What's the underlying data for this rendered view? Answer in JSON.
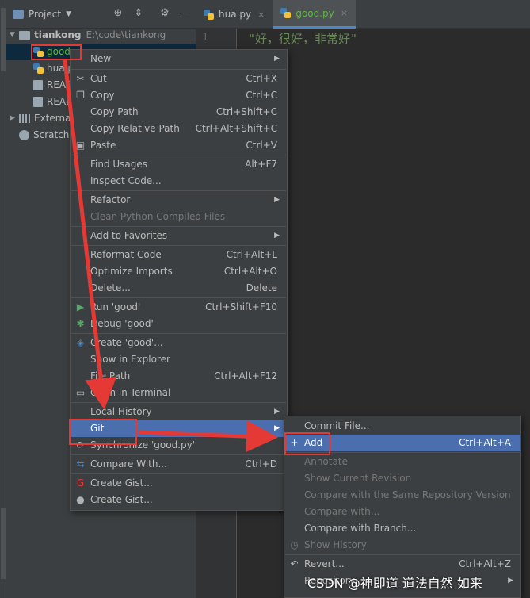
{
  "project_panel": {
    "title": "Project",
    "header_icons": [
      "crosshair-icon",
      "collapse-icon",
      "gear-icon",
      "minimize-icon"
    ],
    "tree": {
      "root_name": "tiankong",
      "root_path": "E:\\code\\tiankong",
      "files": [
        "good.py",
        "hua.py",
        "README",
        "README"
      ],
      "external_libraries": "External Libraries",
      "scratches": "Scratches and Consoles"
    }
  },
  "editor": {
    "tabs": [
      {
        "label": "hua.py",
        "icon": "python-file-icon"
      },
      {
        "label": "good.py",
        "icon": "python-file-icon",
        "active": true
      }
    ],
    "close_glyph": "×",
    "line_number": "1",
    "code": "\"好，很好，非常好\""
  },
  "context_menu": {
    "items": [
      {
        "label": "New",
        "shortcut": "",
        "submenu": true
      },
      {
        "label": "Cut",
        "shortcut": "Ctrl+X",
        "icon": "scissors-icon"
      },
      {
        "label": "Copy",
        "shortcut": "Ctrl+C",
        "icon": "copy-icon"
      },
      {
        "label": "Copy Path",
        "shortcut": "Ctrl+Shift+C"
      },
      {
        "label": "Copy Relative Path",
        "shortcut": "Ctrl+Alt+Shift+C"
      },
      {
        "label": "Paste",
        "shortcut": "Ctrl+V",
        "icon": "clipboard-icon"
      },
      {
        "label": "Find Usages",
        "shortcut": "Alt+F7"
      },
      {
        "label": "Inspect Code...",
        "shortcut": ""
      },
      {
        "label": "Refactor",
        "shortcut": "",
        "submenu": true
      },
      {
        "label": "Clean Python Compiled Files",
        "shortcut": "",
        "disabled": true
      },
      {
        "label": "Add to Favorites",
        "shortcut": "",
        "submenu": true
      },
      {
        "label": "Reformat Code",
        "shortcut": "Ctrl+Alt+L"
      },
      {
        "label": "Optimize Imports",
        "shortcut": "Ctrl+Alt+O"
      },
      {
        "label": "Delete...",
        "shortcut": "Delete"
      },
      {
        "label": "Run 'good'",
        "shortcut": "Ctrl+Shift+F10",
        "icon": "run-icon"
      },
      {
        "label": "Debug 'good'",
        "shortcut": "",
        "icon": "debug-icon"
      },
      {
        "label": "Create 'good'...",
        "shortcut": "",
        "icon": "python-icon"
      },
      {
        "label": "Show in Explorer",
        "shortcut": ""
      },
      {
        "label": "File Path",
        "shortcut": "Ctrl+Alt+F12"
      },
      {
        "label": "Open in Terminal",
        "shortcut": "",
        "icon": "terminal-icon"
      },
      {
        "label": "Local History",
        "shortcut": "",
        "submenu": true
      },
      {
        "label": "Git",
        "shortcut": "",
        "submenu": true,
        "highlighted": true
      },
      {
        "label": "Synchronize 'good.py'",
        "shortcut": "",
        "icon": "sync-icon"
      },
      {
        "label": "Compare With...",
        "shortcut": "Ctrl+D",
        "icon": "compare-icon"
      },
      {
        "label": "Create Gist...",
        "shortcut": "",
        "icon": "gist-g-icon"
      },
      {
        "label": "Create Gist...",
        "shortcut": "",
        "icon": "github-icon"
      }
    ]
  },
  "git_submenu": {
    "items": [
      {
        "label": "Commit File...",
        "shortcut": ""
      },
      {
        "label": "Add",
        "shortcut": "Ctrl+Alt+A",
        "icon": "plus-icon",
        "highlighted": true
      },
      {
        "label": "Annotate",
        "shortcut": "",
        "disabled": true
      },
      {
        "label": "Show Current Revision",
        "shortcut": "",
        "disabled": true
      },
      {
        "label": "Compare with the Same Repository Version",
        "shortcut": "",
        "disabled": true
      },
      {
        "label": "Compare with...",
        "shortcut": "",
        "disabled": true
      },
      {
        "label": "Compare with Branch...",
        "shortcut": ""
      },
      {
        "label": "Show History",
        "shortcut": "",
        "disabled": true,
        "icon": "history-icon"
      },
      {
        "label": "Revert...",
        "shortcut": "Ctrl+Alt+Z",
        "icon": "revert-icon"
      },
      {
        "label": "Repository",
        "shortcut": "",
        "submenu": true
      }
    ]
  },
  "colors": {
    "highlight": "#4b6eaf",
    "annotation_red": "#e53935"
  },
  "watermark": "CSDN @神即道 道法自然 如来"
}
